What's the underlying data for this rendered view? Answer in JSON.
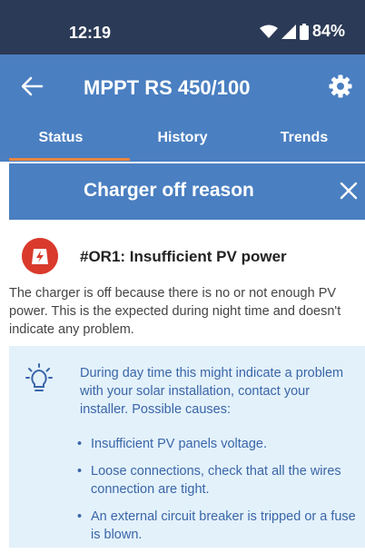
{
  "status_bar": {
    "time": "12:19",
    "battery": "84%"
  },
  "app_bar": {
    "title": "MPPT RS 450/100"
  },
  "tabs": [
    {
      "label": "Status"
    },
    {
      "label": "History"
    },
    {
      "label": "Trends"
    }
  ],
  "reason": {
    "title": "Charger off reason"
  },
  "error": {
    "title": "#OR1: Insufficient PV power",
    "description": "The charger is off because there is no or not enough PV power. This is the expected during night time and doesn't indicate any problem."
  },
  "info": {
    "text": "During day time this might indicate a problem with your solar installation, contact your installer. Possible causes:",
    "causes": [
      "Insufficient PV panels voltage.",
      "Loose connections, check that all the wires connection are tight.",
      "An external circuit breaker is tripped or a fuse is blown."
    ]
  },
  "icons": {
    "back": "arrow-left-icon",
    "settings": "gear-icon",
    "close": "close-icon",
    "error": "solar-error-icon",
    "tip": "lightbulb-icon",
    "wifi": "wifi-icon",
    "signal": "signal-icon",
    "battery": "battery-icon"
  },
  "colors": {
    "status_bar": "#2b3a56",
    "primary": "#4a7fc1",
    "accent": "#e8863f",
    "error": "#d93a2b",
    "info_bg": "#e3f1fb",
    "info_text": "#3a66a8"
  }
}
